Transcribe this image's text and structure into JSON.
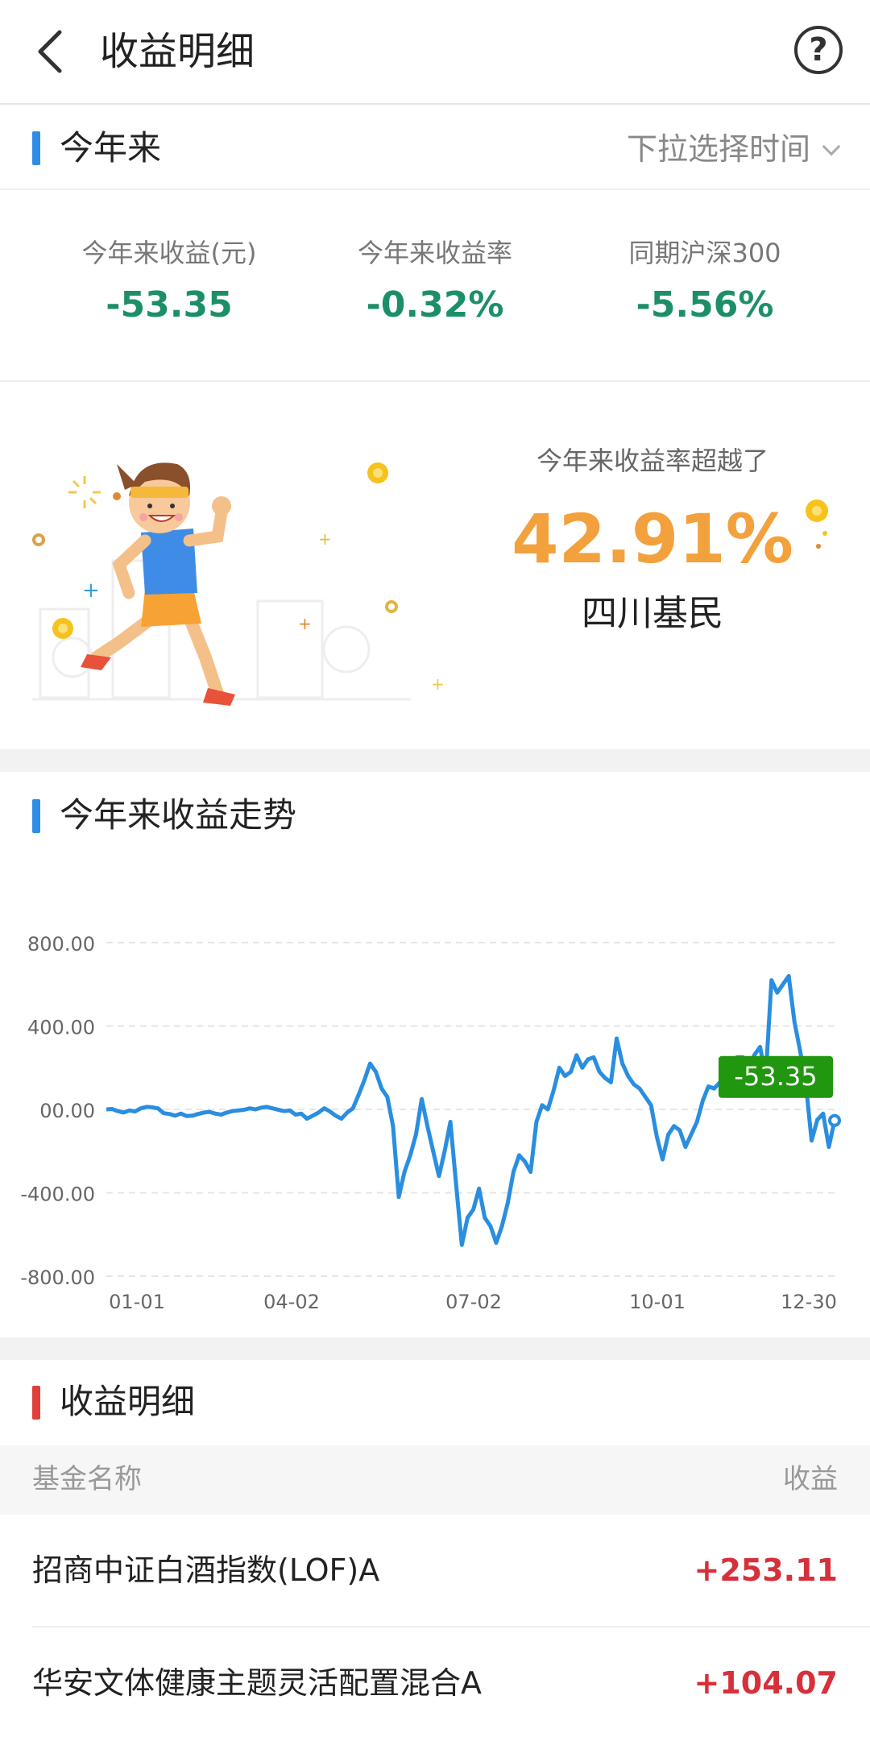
{
  "header": {
    "title": "收益明细",
    "back_icon": "chevron-left-icon",
    "help_icon": "question-circle-icon",
    "help_glyph": "?"
  },
  "period": {
    "title": "今年来",
    "dropdown_label": "下拉选择时间",
    "accent": "#2f8de4"
  },
  "stats": [
    {
      "label": "今年来收益(元)",
      "value": "-53.35"
    },
    {
      "label": "今年来收益率",
      "value": "-0.32%"
    },
    {
      "label": "同期沪深300",
      "value": "-5.56%"
    }
  ],
  "promo": {
    "label": "今年来收益率超越了",
    "percent": "42.91%",
    "group": "四川基民"
  },
  "trend": {
    "title": "今年来收益走势"
  },
  "chart_data": {
    "type": "line",
    "ylim": [
      -800,
      800
    ],
    "y_ticks": [
      "800.00",
      "400.00",
      "00.00",
      "-400.00",
      "-800.00"
    ],
    "x_ticks": [
      "01-01",
      "04-02",
      "07-02",
      "10-01",
      "12-30"
    ],
    "grid": true,
    "line_color": "#2a8ee0",
    "tooltip": {
      "label": "-53.35",
      "color": "#21960f"
    },
    "series": [
      {
        "values": [
          0,
          2,
          -8,
          -15,
          -5,
          -10,
          5,
          12,
          10,
          5,
          -18,
          -22,
          -30,
          -20,
          -32,
          -30,
          -22,
          -15,
          -12,
          -20,
          -25,
          -15,
          -8,
          -5,
          -2,
          5,
          0,
          8,
          12,
          5,
          -2,
          -8,
          -5,
          -25,
          -20,
          -45,
          -30,
          -15,
          5,
          -10,
          -30,
          -45,
          -15,
          5,
          70,
          140,
          220,
          180,
          100,
          60,
          -80,
          -420,
          -300,
          -220,
          -120,
          50,
          -80,
          -200,
          -320,
          -200,
          -60,
          -360,
          -650,
          -520,
          -480,
          -380,
          -520,
          -560,
          -640,
          -560,
          -450,
          -300,
          -220,
          -250,
          -300,
          -60,
          20,
          0,
          90,
          200,
          160,
          180,
          260,
          200,
          240,
          250,
          180,
          150,
          130,
          340,
          220,
          160,
          120,
          100,
          60,
          20,
          -130,
          -240,
          -120,
          -80,
          -100,
          -180,
          -120,
          -60,
          40,
          110,
          100,
          130,
          150,
          180,
          250,
          250,
          190,
          260,
          300,
          160,
          620,
          560,
          600,
          640,
          420,
          280,
          120,
          -150,
          -50,
          -20,
          -180,
          -53.35
        ]
      }
    ]
  },
  "detail": {
    "title": "收益明细",
    "accent": "#e0403a",
    "col_name": "基金名称",
    "col_profit": "收益",
    "rows": [
      {
        "name": "招商中证白酒指数(LOF)A",
        "profit": "+253.11"
      },
      {
        "name": "华安文体健康主题灵活配置混合A",
        "profit": "+104.07"
      }
    ]
  }
}
